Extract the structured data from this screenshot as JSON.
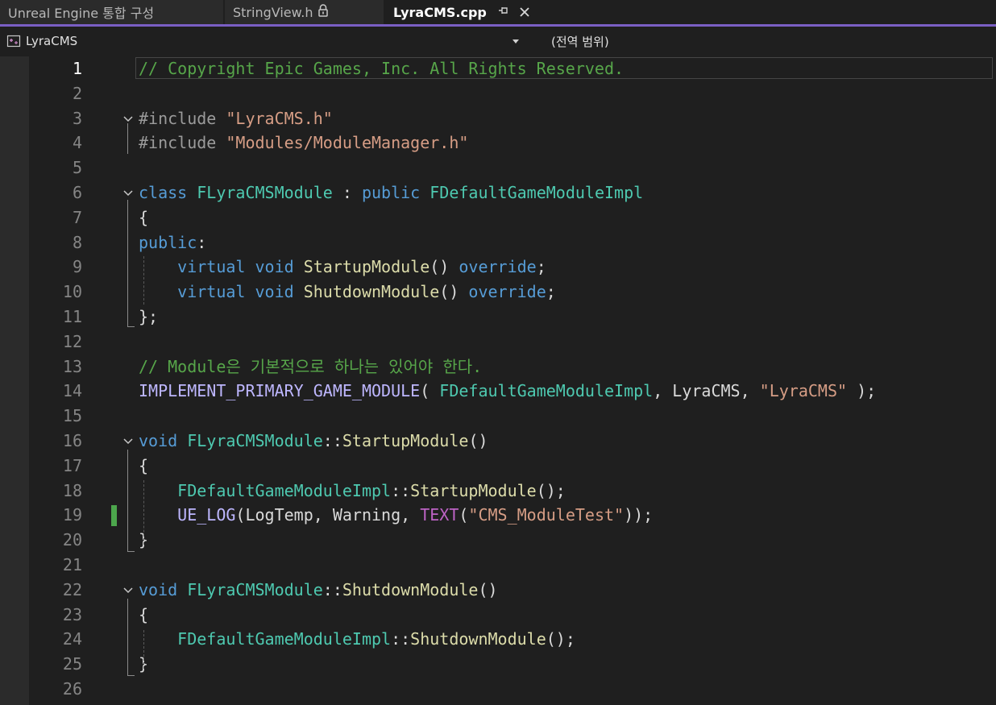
{
  "tabs": [
    {
      "label": "Unreal Engine 통합 구성",
      "active": false,
      "locked": false
    },
    {
      "label": "StringView.h",
      "active": false,
      "locked": true
    },
    {
      "label": "LyraCMS.cpp",
      "active": true,
      "locked": false
    }
  ],
  "navigation": {
    "scope": "LyraCMS",
    "member": "(전역 범위)"
  },
  "colors": {
    "comment": "#57a64a",
    "keyword": "#569cd6",
    "type": "#4ec9b0",
    "string": "#d69d85",
    "function": "#dcdcaa",
    "macro": "#beb7ff",
    "changed_marker": "#4ca64c",
    "active_tab_underline": "#7a5fc4"
  },
  "editor": {
    "current_line": 1,
    "changed_lines": [
      19
    ],
    "lines": [
      {
        "n": "1",
        "tokens": [
          [
            "comment",
            "// Copyright Epic Games, Inc. All Rights Reserved."
          ]
        ]
      },
      {
        "n": "2",
        "tokens": []
      },
      {
        "n": "3",
        "tokens": [
          [
            "pre",
            "#include "
          ],
          [
            "str",
            "\"LyraCMS.h\""
          ]
        ]
      },
      {
        "n": "4",
        "tokens": [
          [
            "pre",
            "#include "
          ],
          [
            "str",
            "\"Modules/ModuleManager.h\""
          ]
        ]
      },
      {
        "n": "5",
        "tokens": []
      },
      {
        "n": "6",
        "tokens": [
          [
            "kw",
            "class "
          ],
          [
            "type",
            "FLyraCMSModule"
          ],
          [
            "plain",
            " : "
          ],
          [
            "kw",
            "public "
          ],
          [
            "type",
            "FDefaultGameModuleImpl"
          ]
        ]
      },
      {
        "n": "7",
        "tokens": [
          [
            "plain",
            "{"
          ]
        ]
      },
      {
        "n": "8",
        "tokens": [
          [
            "kw",
            "public"
          ],
          [
            "plain",
            ":"
          ]
        ]
      },
      {
        "n": "9",
        "tokens": [
          [
            "plain",
            "    "
          ],
          [
            "kw",
            "virtual void "
          ],
          [
            "fn",
            "StartupModule"
          ],
          [
            "plain",
            "() "
          ],
          [
            "kw",
            "override"
          ],
          [
            "plain",
            ";"
          ]
        ]
      },
      {
        "n": "10",
        "tokens": [
          [
            "plain",
            "    "
          ],
          [
            "kw",
            "virtual void "
          ],
          [
            "fn",
            "ShutdownModule"
          ],
          [
            "plain",
            "() "
          ],
          [
            "kw",
            "override"
          ],
          [
            "plain",
            ";"
          ]
        ]
      },
      {
        "n": "11",
        "tokens": [
          [
            "plain",
            "};"
          ]
        ]
      },
      {
        "n": "12",
        "tokens": []
      },
      {
        "n": "13",
        "tokens": [
          [
            "comment",
            "// Module은 기본적으로 하나는 있어야 한다."
          ]
        ]
      },
      {
        "n": "14",
        "tokens": [
          [
            "macroname",
            "IMPLEMENT_PRIMARY_GAME_MODULE"
          ],
          [
            "plain",
            "( "
          ],
          [
            "type",
            "FDefaultGameModuleImpl"
          ],
          [
            "plain",
            ", LyraCMS, "
          ],
          [
            "str",
            "\"LyraCMS\""
          ],
          [
            "plain",
            " );"
          ]
        ]
      },
      {
        "n": "15",
        "tokens": []
      },
      {
        "n": "16",
        "tokens": [
          [
            "kw",
            "void "
          ],
          [
            "type",
            "FLyraCMSModule"
          ],
          [
            "plain",
            "::"
          ],
          [
            "fn",
            "StartupModule"
          ],
          [
            "plain",
            "()"
          ]
        ]
      },
      {
        "n": "17",
        "tokens": [
          [
            "plain",
            "{"
          ]
        ]
      },
      {
        "n": "18",
        "tokens": [
          [
            "plain",
            "    "
          ],
          [
            "type",
            "FDefaultGameModuleImpl"
          ],
          [
            "plain",
            "::"
          ],
          [
            "fn",
            "StartupModule"
          ],
          [
            "plain",
            "();"
          ]
        ]
      },
      {
        "n": "19",
        "tokens": [
          [
            "plain",
            "    "
          ],
          [
            "macroname",
            "UE_LOG"
          ],
          [
            "plain",
            "(LogTemp, Warning, "
          ],
          [
            "macro",
            "TEXT"
          ],
          [
            "plain",
            "("
          ],
          [
            "str",
            "\"CMS_ModuleTest\""
          ],
          [
            "plain",
            "));"
          ]
        ]
      },
      {
        "n": "20",
        "tokens": [
          [
            "plain",
            "}"
          ]
        ]
      },
      {
        "n": "21",
        "tokens": []
      },
      {
        "n": "22",
        "tokens": [
          [
            "kw",
            "void "
          ],
          [
            "type",
            "FLyraCMSModule"
          ],
          [
            "plain",
            "::"
          ],
          [
            "fn",
            "ShutdownModule"
          ],
          [
            "plain",
            "()"
          ]
        ]
      },
      {
        "n": "23",
        "tokens": [
          [
            "plain",
            "{"
          ]
        ]
      },
      {
        "n": "24",
        "tokens": [
          [
            "plain",
            "    "
          ],
          [
            "type",
            "FDefaultGameModuleImpl"
          ],
          [
            "plain",
            "::"
          ],
          [
            "fn",
            "ShutdownModule"
          ],
          [
            "plain",
            "();"
          ]
        ]
      },
      {
        "n": "25",
        "tokens": [
          [
            "plain",
            "}"
          ]
        ]
      },
      {
        "n": "26",
        "tokens": []
      }
    ]
  }
}
